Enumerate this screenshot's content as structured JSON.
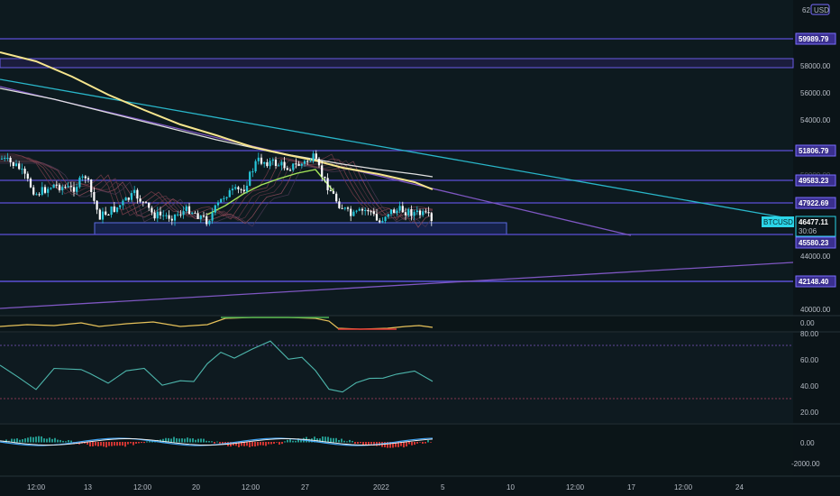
{
  "currency": "USD",
  "price_top_cut": "62",
  "symbol": "BTCUSD",
  "last_price": "46477.11",
  "countdown": "30:06",
  "level_tags": [
    {
      "value": 59989.79,
      "label": "59989.79"
    },
    {
      "value": 51806.79,
      "label": "51806.79"
    },
    {
      "value": 49583.23,
      "label": "49583.23"
    },
    {
      "value": 47922.69,
      "label": "47922.69"
    },
    {
      "value": 45580.23,
      "label": "45580.23"
    },
    {
      "value": 42148.4,
      "label": "42148.40"
    }
  ],
  "price_ticks": [
    "58000.00",
    "56000.00",
    "54000.00",
    "50000.00",
    "44000.00",
    "40000.00"
  ],
  "osc1_ticks": [
    "0.00"
  ],
  "rsi_ticks": [
    "80.00",
    "60.00",
    "40.00",
    "20.00"
  ],
  "macd_ticks": [
    "0.00",
    "-2000.00"
  ],
  "time_labels": [
    "12:00",
    "13",
    "12:00",
    "20",
    "12:00",
    "27",
    "2022",
    "5",
    "10",
    "12:00",
    "17",
    "12:00",
    "24"
  ],
  "colors": {
    "background": "#0b1418",
    "level_line": "#5b4fd6",
    "tag_bg": "#3a2f8f",
    "tag_border": "#7a6cff",
    "teal_trend": "#29b6c9",
    "purple_trend": "#7e57c2",
    "yellow_ma": "#f6e58d",
    "white_ma": "#e0e0e0",
    "green_ribbon": "#a5e65a",
    "candle_up": "#26c6da",
    "candle_down": "#ffffff",
    "rsi_line": "#4db6ac",
    "price_label_bg": "#2bd5e8"
  },
  "chart_data": {
    "type": "candlestick",
    "symbol": "BTCUSD",
    "currency": "USD",
    "x": [
      "12:00",
      "13",
      "12:00",
      "20",
      "12:00",
      "27",
      "2022",
      "5",
      "10",
      "12:00",
      "17",
      "12:00",
      "24"
    ],
    "price_ylim": [
      39500,
      62000
    ],
    "horizontal_levels": [
      59989.79,
      58500,
      51806.79,
      49583.23,
      47922.69,
      45580.23,
      42148.4
    ],
    "last_price": 46477.11,
    "rsi_ylim": [
      15,
      85
    ],
    "rsi_levels": [
      70,
      30
    ],
    "macd_ticks": [
      0,
      -2000
    ]
  }
}
